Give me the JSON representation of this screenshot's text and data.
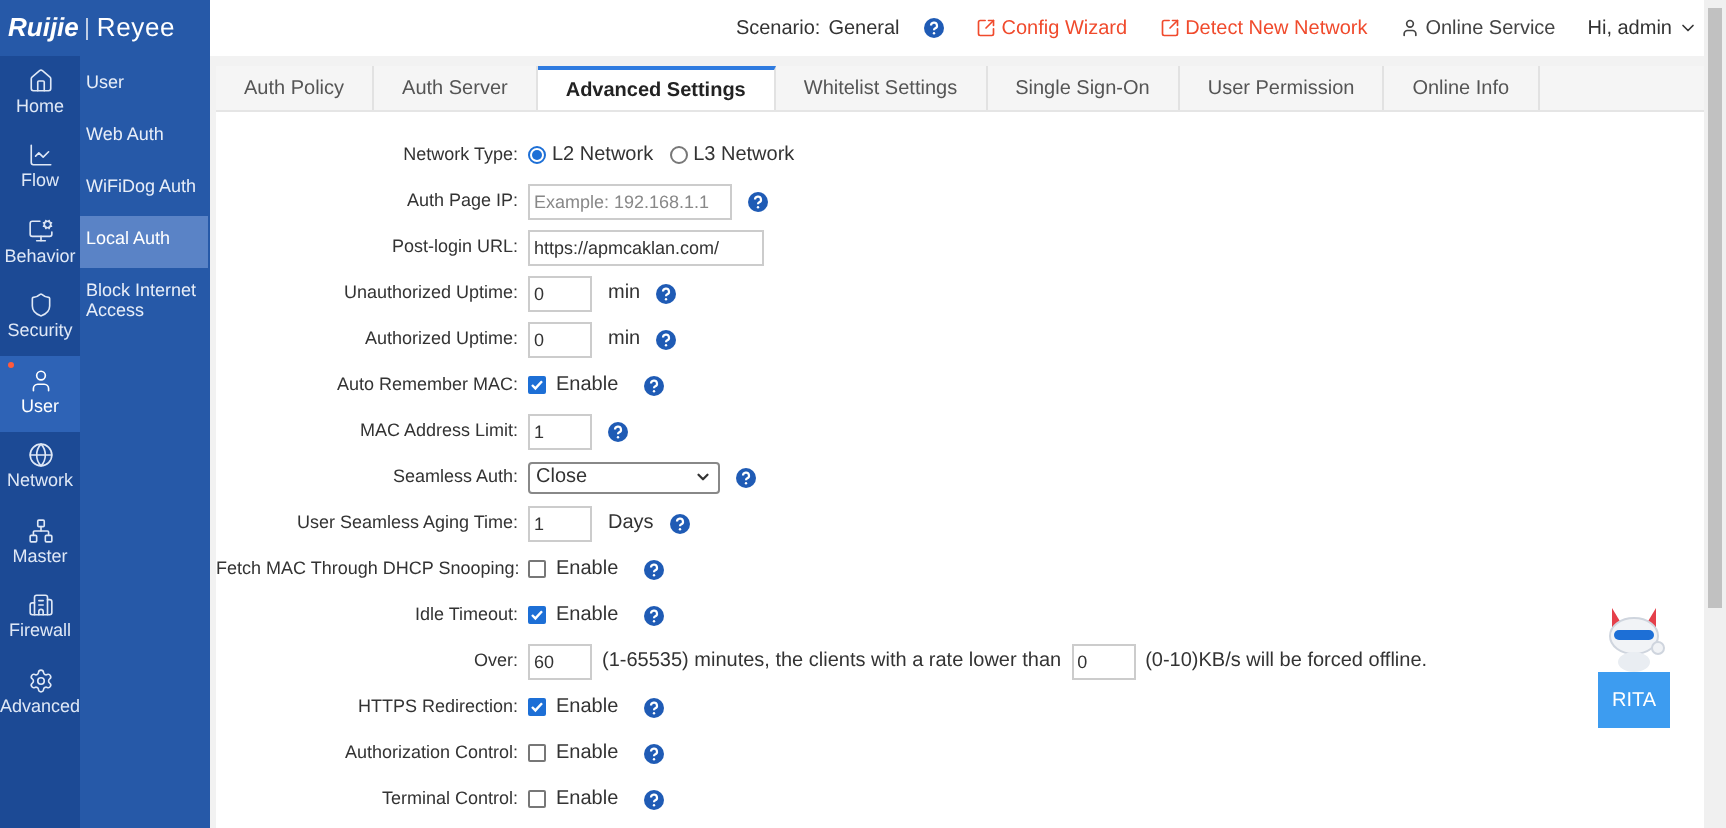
{
  "logo": {
    "brand": "Ruijie",
    "product": "Reyee"
  },
  "header": {
    "scenario_label": "Scenario:",
    "scenario_value": "General",
    "links": [
      {
        "label": "Config Wizard",
        "kind": "alert"
      },
      {
        "label": "Detect New Network",
        "kind": "alert"
      },
      {
        "label": "Online Service",
        "kind": "person"
      }
    ],
    "user": "Hi, admin"
  },
  "nav": [
    {
      "label": "Home",
      "selected": false,
      "badge": false
    },
    {
      "label": "Flow",
      "selected": false,
      "badge": false
    },
    {
      "label": "Behavior",
      "selected": false,
      "badge": false
    },
    {
      "label": "Security",
      "selected": false,
      "badge": false
    },
    {
      "label": "User",
      "selected": true,
      "badge": true
    },
    {
      "label": "Network",
      "selected": false,
      "badge": false
    },
    {
      "label": "Master",
      "selected": false,
      "badge": false
    },
    {
      "label": "Firewall",
      "selected": false,
      "badge": false
    },
    {
      "label": "Advanced",
      "selected": false,
      "badge": false
    }
  ],
  "submenu": [
    {
      "label": "User",
      "selected": false
    },
    {
      "label": "Web Auth",
      "selected": false
    },
    {
      "label": "WiFiDog Auth",
      "selected": false
    },
    {
      "label": "Local Auth",
      "selected": true
    },
    {
      "label": "Block Internet Access",
      "selected": false
    }
  ],
  "tabs": [
    {
      "label": "Auth Policy",
      "selected": false
    },
    {
      "label": "Auth Server",
      "selected": false
    },
    {
      "label": "Advanced Settings",
      "selected": true
    },
    {
      "label": "Whitelist Settings",
      "selected": false
    },
    {
      "label": "Single Sign-On",
      "selected": false
    },
    {
      "label": "User Permission",
      "selected": false
    },
    {
      "label": "Online Info",
      "selected": false
    }
  ],
  "rows": [
    {
      "kind": "radio",
      "label": "Network Type:",
      "options": [
        {
          "label": "L2 Network",
          "selected": true
        },
        {
          "label": "L3 Network",
          "selected": false
        }
      ]
    },
    {
      "kind": "input",
      "label": "Auth Page IP:",
      "placeholder": "Example: 192.168.1.1",
      "help": true
    },
    {
      "kind": "input",
      "label": "Post-login URL:",
      "value": "https://apmcaklan.com/"
    },
    {
      "kind": "input",
      "label": "Unauthorized Uptime:",
      "value": "0",
      "unit": "min",
      "help": true
    },
    {
      "kind": "input",
      "label": "Authorized Uptime:",
      "value": "0",
      "unit": "min",
      "help": true
    },
    {
      "kind": "checkbox",
      "label": "Auto Remember MAC:",
      "text": "Enable",
      "checked": true,
      "help": true
    },
    {
      "kind": "input",
      "label": "MAC Address Limit:",
      "value": "1",
      "help": true
    },
    {
      "kind": "select",
      "label": "Seamless Auth:",
      "value": "Close",
      "help": true
    },
    {
      "kind": "input",
      "label": "User Seamless Aging Time:",
      "value": "1",
      "unit": "Days",
      "help": true
    },
    {
      "kind": "checkbox",
      "label": "Fetch MAC Through DHCP Snooping:",
      "text": "Enable",
      "checked": false,
      "help": true
    },
    {
      "kind": "checkbox",
      "label": "Idle Timeout:",
      "text": "Enable",
      "checked": true,
      "help": true
    },
    {
      "kind": "over",
      "label": "Over:",
      "value": "60",
      "text": "(1-65535) minutes, the clients with a rate lower than",
      "value2": "0",
      "text2": "(0-10)KB/s will be forced offline."
    },
    {
      "kind": "checkbox",
      "label": "HTTPS Redirection:",
      "text": "Enable",
      "checked": true,
      "help": true
    },
    {
      "kind": "checkbox",
      "label": "Authorization Control:",
      "text": "Enable",
      "checked": false,
      "help": true
    },
    {
      "kind": "checkbox",
      "label": "Terminal Control:",
      "text": "Enable",
      "checked": false,
      "help": true
    }
  ],
  "assistant": {
    "label": "RITA"
  }
}
